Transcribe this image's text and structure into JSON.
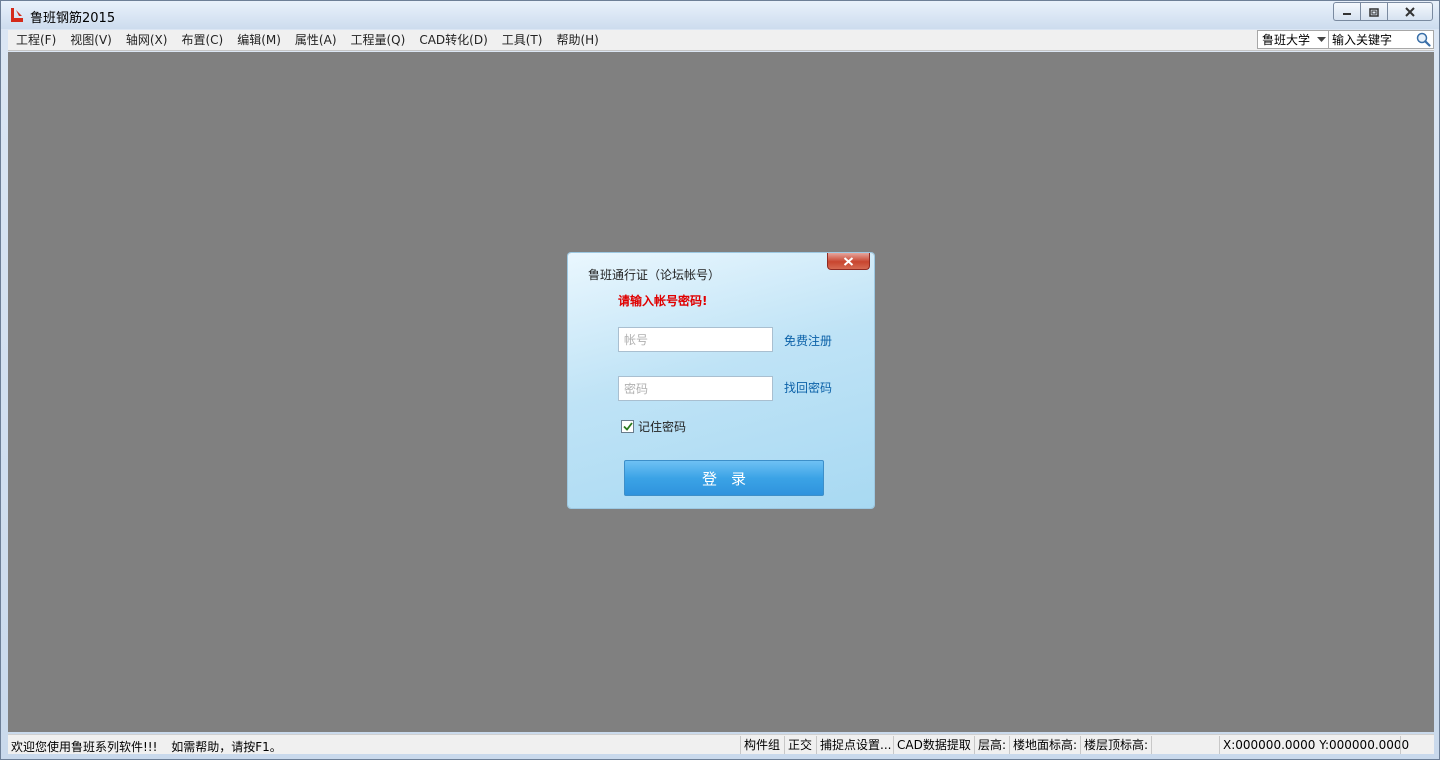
{
  "window": {
    "title": "鲁班钢筋2015",
    "icon": "luban-logo-icon"
  },
  "menu": {
    "items": [
      {
        "label": "工程(F)"
      },
      {
        "label": "视图(V)"
      },
      {
        "label": "轴网(X)"
      },
      {
        "label": "布置(C)"
      },
      {
        "label": "编辑(M)"
      },
      {
        "label": "属性(A)"
      },
      {
        "label": "工程量(Q)"
      },
      {
        "label": "CAD转化(D)"
      },
      {
        "label": "工具(T)"
      },
      {
        "label": "帮助(H)"
      }
    ]
  },
  "search": {
    "scope_selected": "鲁班大学",
    "keyword_placeholder": "输入关键字"
  },
  "dialog": {
    "title": "鲁班通行证（论坛帐号）",
    "error": "请输入帐号密码!",
    "account_placeholder": "帐号",
    "password_placeholder": "密码",
    "register_link": "免费注册",
    "recover_link": "找回密码",
    "remember_label": "记住密码",
    "remember_checked": true,
    "login_label": "登录"
  },
  "status": {
    "welcome": "欢迎您使用鲁班系列软件!!!",
    "help": "如需帮助，请按F1。",
    "panels": {
      "component_group": "构件组",
      "ortho": "正交",
      "snap": "捕捉点设置...",
      "cad_extract": "CAD数据提取",
      "floor_height": "层高:",
      "floor_ground_elev": "楼地面标高:",
      "floor_top_elev": "楼层顶标高:",
      "coords": "X:000000.0000 Y:000000.0000"
    }
  },
  "colors": {
    "workspace": "#808080",
    "error_text": "#e00000",
    "link": "#0b61a8",
    "login_button": "#3ba3e6"
  }
}
